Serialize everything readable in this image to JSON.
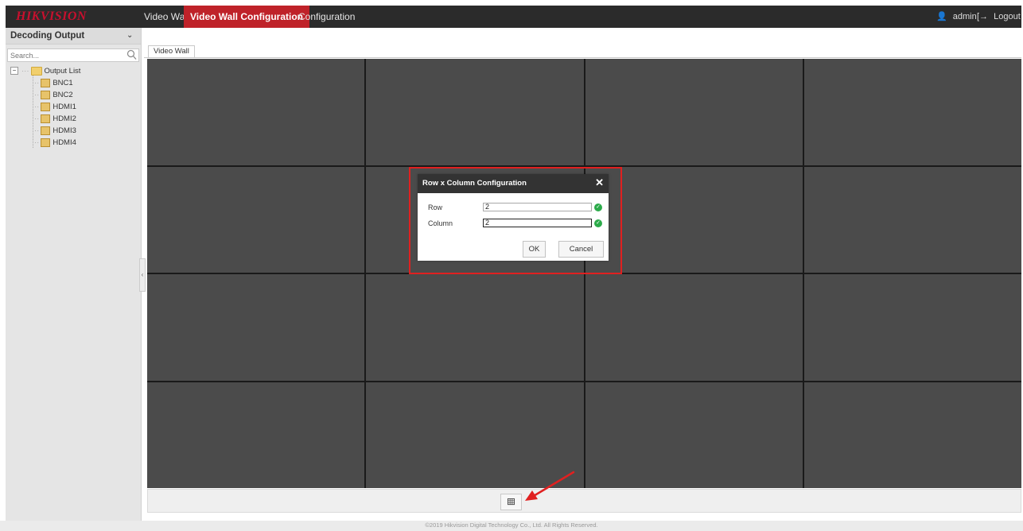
{
  "app": {
    "brand": "HIKVISION",
    "nav": [
      "Video Wall",
      "Video Wall Configuration",
      "Configuration"
    ],
    "active_nav": "Video Wall Configuration",
    "user": "admin",
    "logout_label": "Logout",
    "colors": {
      "topbar": "#2b2b2b",
      "active_tab": "#bf2229",
      "wall_cell": "#4b4b4b",
      "highlight": "#e02020",
      "check": "#2cab4a"
    }
  },
  "sidebar": {
    "title": "Decoding Output",
    "search_placeholder": "Search...",
    "tree_root": "Output List",
    "outputs": [
      "BNC1",
      "BNC2",
      "HDMI1",
      "HDMI2",
      "HDMI3",
      "HDMI4"
    ]
  },
  "main": {
    "tab": "Video Wall",
    "wall_rows": 4,
    "wall_columns": 4
  },
  "dialog": {
    "title": "Row x Column Configuration",
    "row_label": "Row",
    "row_value": "2",
    "column_label": "Column",
    "column_value": "2",
    "ok_label": "OK",
    "cancel_label": "Cancel"
  },
  "footer": {
    "text": "©2019 Hikvision Digital Technology Co., Ltd. All Rights Reserved."
  }
}
